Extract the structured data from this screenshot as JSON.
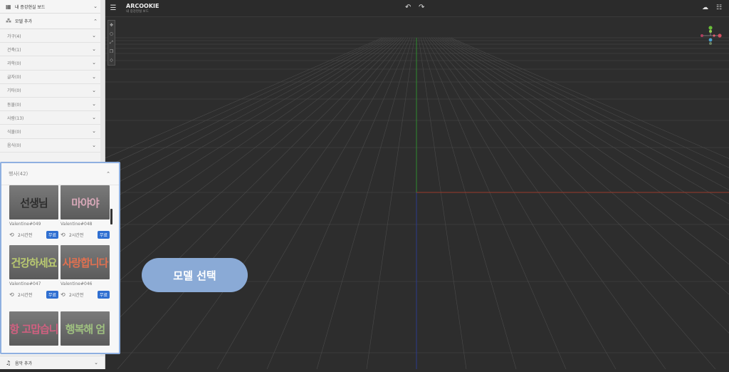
{
  "sidebar": {
    "ar_board_label": "내 증강현실 보드",
    "add_model_label": "모델 추가",
    "categories": [
      {
        "label": "가구(4)"
      },
      {
        "label": "건축(1)"
      },
      {
        "label": "과학(0)"
      },
      {
        "label": "글자(0)"
      },
      {
        "label": "기타(0)"
      },
      {
        "label": "동물(0)"
      },
      {
        "label": "사람(13)"
      },
      {
        "label": "식물(0)"
      },
      {
        "label": "음식(0)"
      }
    ],
    "add_music_label": "음악 추가"
  },
  "topbar": {
    "title": "ARCOOKIE",
    "subtitle": "내 증강현실 보드"
  },
  "panel": {
    "category_label": "행사(42)",
    "models": [
      {
        "name": "Valentine#049",
        "thumb_text": "선생님",
        "thumb_color": "#2e2e2e",
        "time": "2시간전",
        "badge": "무료"
      },
      {
        "name": "Valentine#048",
        "thumb_text": "마야야",
        "thumb_color": "#d8a8b8",
        "time": "2시간전",
        "badge": "무료"
      },
      {
        "name": "Valentine#047",
        "thumb_text": "건강하세요",
        "thumb_color": "#b8c870",
        "time": "2시간전",
        "badge": "무료"
      },
      {
        "name": "Valentine#046",
        "thumb_text": "사랑합니다",
        "thumb_color": "#e07050",
        "time": "2시간전",
        "badge": "무료"
      },
      {
        "name": "",
        "thumb_text": "항 고맙습니",
        "thumb_color": "#d06080",
        "time": "",
        "badge": ""
      },
      {
        "name": "",
        "thumb_text": "행복해 엄",
        "thumb_color": "#9fc080",
        "time": "",
        "badge": ""
      }
    ]
  },
  "callout": {
    "label": "모델 선택",
    "color": "#8aaad6"
  },
  "colors": {
    "viewport_bg": "#2d2d2d",
    "grid_line": "#4a4a4a",
    "y_axis": "#2e8b2e",
    "x_axis": "#9b3a2a",
    "z_axis": "#2a3a8b",
    "badge_bg": "#2f6fd1",
    "panel_border": "#8fb0e0"
  }
}
